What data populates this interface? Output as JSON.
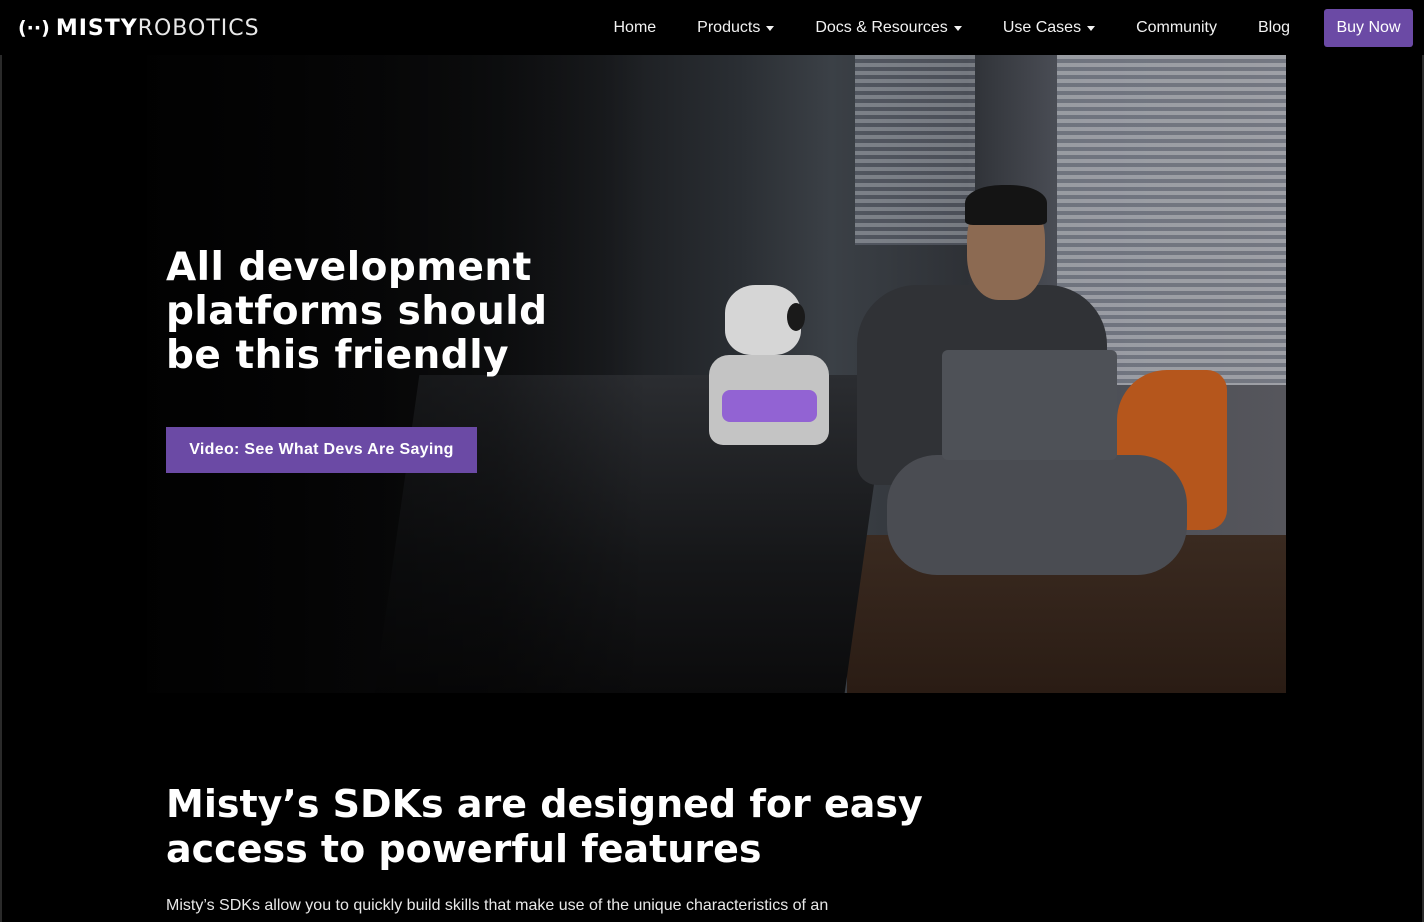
{
  "header": {
    "logo_mark": "(··)",
    "logo_bold": "MISTY",
    "logo_light": "ROBOTICS",
    "nav": [
      {
        "label": "Home",
        "dropdown": false
      },
      {
        "label": "Products",
        "dropdown": true
      },
      {
        "label": "Docs & Resources",
        "dropdown": true
      },
      {
        "label": "Use Cases",
        "dropdown": true
      },
      {
        "label": "Community",
        "dropdown": false
      },
      {
        "label": "Blog",
        "dropdown": false
      }
    ],
    "buy_label": "Buy Now"
  },
  "hero": {
    "title": "All development platforms should be this friendly",
    "button_label": "Video: See What Devs Are Saying"
  },
  "section": {
    "title": "Misty’s SDKs are designed for easy access to powerful features",
    "text": "Misty’s SDKs allow you to quickly build skills that make use of the unique characteristics of an"
  },
  "colors": {
    "accent": "#6b4aa5",
    "background": "#000000"
  }
}
